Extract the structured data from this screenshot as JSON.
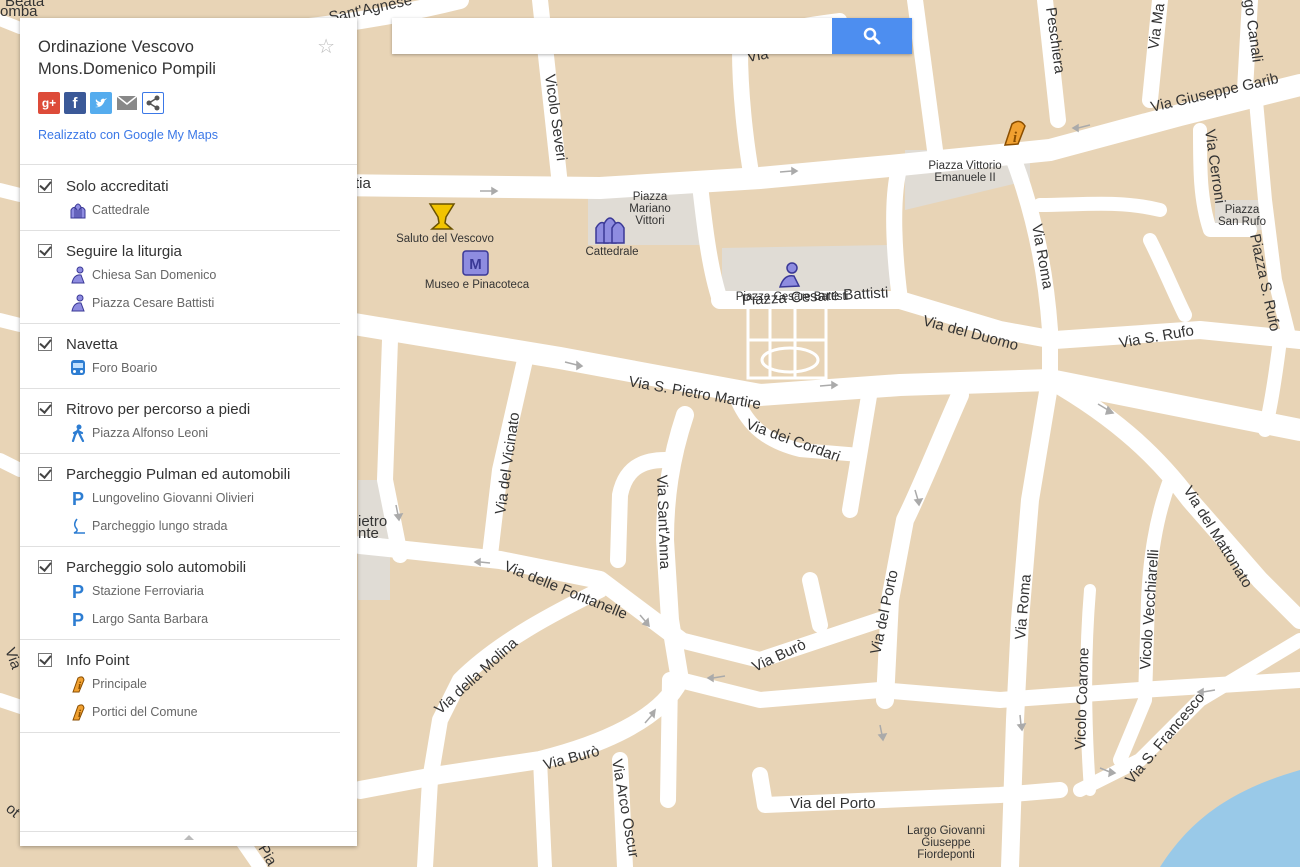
{
  "title": "Ordinazione Vescovo Mons.Domenico Pompili",
  "made_with": "Realizzato con Google My Maps",
  "search": {
    "placeholder": ""
  },
  "share": [
    "google-plus",
    "facebook",
    "twitter",
    "email",
    "share"
  ],
  "colors": {
    "land": "#e8d4b6",
    "road": "#ffffff",
    "water": "#99c9e8",
    "square": "#e0dcd5",
    "search_button": "#4d8ef0",
    "link": "#3b78e7"
  },
  "layers": [
    {
      "name": "Solo accreditati",
      "items": [
        {
          "label": "Cattedrale",
          "icon": "cathedral-icon"
        }
      ]
    },
    {
      "name": "Seguire la liturgia",
      "items": [
        {
          "label": "Chiesa San Domenico",
          "icon": "person-kneeling-icon"
        },
        {
          "label": "Piazza Cesare Battisti",
          "icon": "person-kneeling-icon"
        }
      ]
    },
    {
      "name": "Navetta",
      "items": [
        {
          "label": "Foro Boario",
          "icon": "bus-icon"
        }
      ]
    },
    {
      "name": "Ritrovo per percorso a piedi",
      "items": [
        {
          "label": "Piazza Alfonso Leoni",
          "icon": "walking-person-icon"
        }
      ]
    },
    {
      "name": "Parcheggio Pulman ed automobili",
      "items": [
        {
          "label": "Lungovelino Giovanni Olivieri",
          "icon": "parking-icon"
        },
        {
          "label": "Parcheggio lungo strada",
          "icon": "line-icon"
        }
      ]
    },
    {
      "name": "Parcheggio solo automobili",
      "items": [
        {
          "label": "Stazione Ferroviaria",
          "icon": "parking-icon"
        },
        {
          "label": "Largo Santa Barbara",
          "icon": "parking-icon"
        }
      ]
    },
    {
      "name": "Info Point",
      "items": [
        {
          "label": "Principale",
          "icon": "info-icon"
        },
        {
          "label": "Portici del Comune",
          "icon": "info-icon"
        }
      ]
    }
  ],
  "map_streets": {
    "sant_agnese": "Sant'Agnese",
    "vicolo_severi": "Vicolo Severi",
    "via_peschiera": "Peschiera",
    "via_ma": "Via Ma",
    "via_canali": "go Canali",
    "via_garibaldi": "Via Giuseppe Garib",
    "via_cerroni": "Via Cerroni",
    "via_roma_n": "Via Roma",
    "via_duomo": "Via del Duomo",
    "via_s_rufo": "Via S. Rufo",
    "piazza_s_rufo_v": "Piazza S. Rufo",
    "via_s_pietro": "Via S. Pietro Martire",
    "via_cordari": "Via dei Cordari",
    "via_vicinato": "Via del Vicinato",
    "via_santanna": "Via Sant'Anna",
    "via_fontanelle": "Via delle Fontanelle",
    "via_porto_v": "Via del Porto",
    "via_roma_s": "Via Roma",
    "vicolo_vecchiarelli": "Vicolo Vecchiarelli",
    "via_mattonato": "Via del Mattonato",
    "vicolo_coarone": "Vicolo Coarone",
    "via_s_francesco": "Via S. Francesco",
    "via_buro_1": "Via Burò",
    "via_buro_2": "Via Burò",
    "via_molina": "Via della Molina",
    "via_arco": "Via Arco Oscur",
    "via_porto_h": "Via del Porto",
    "piazza_cesare_street": "Piazza Cesare Battisti",
    "via_tia": "tia",
    "via_la": "Via",
    "beata": "Beata",
    "omba": "omba",
    "ietro": "ietro",
    "nte": "nte",
    "via_left": "Via",
    "vot": "ot",
    "pia": "Pia"
  },
  "map_places": {
    "saluto": "Saluto del Vescovo",
    "museo": "Museo e Pinacoteca",
    "cattedrale": "Cattedrale",
    "piazza_mariano_1": "Piazza",
    "piazza_mariano_2": "Mariano",
    "piazza_mariano_3": "Vittori",
    "piazza_vittorio_1": "Piazza Vittorio",
    "piazza_vittorio_2": "Emanuele II",
    "piazza_san_rufo_1": "Piazza",
    "piazza_san_rufo_2": "San Rufo",
    "piazza_cesare": "Piazza Cesare Battisti",
    "largo_1": "Largo Giovanni",
    "largo_2": "Giuseppe",
    "largo_3": "Fiordeponti"
  }
}
